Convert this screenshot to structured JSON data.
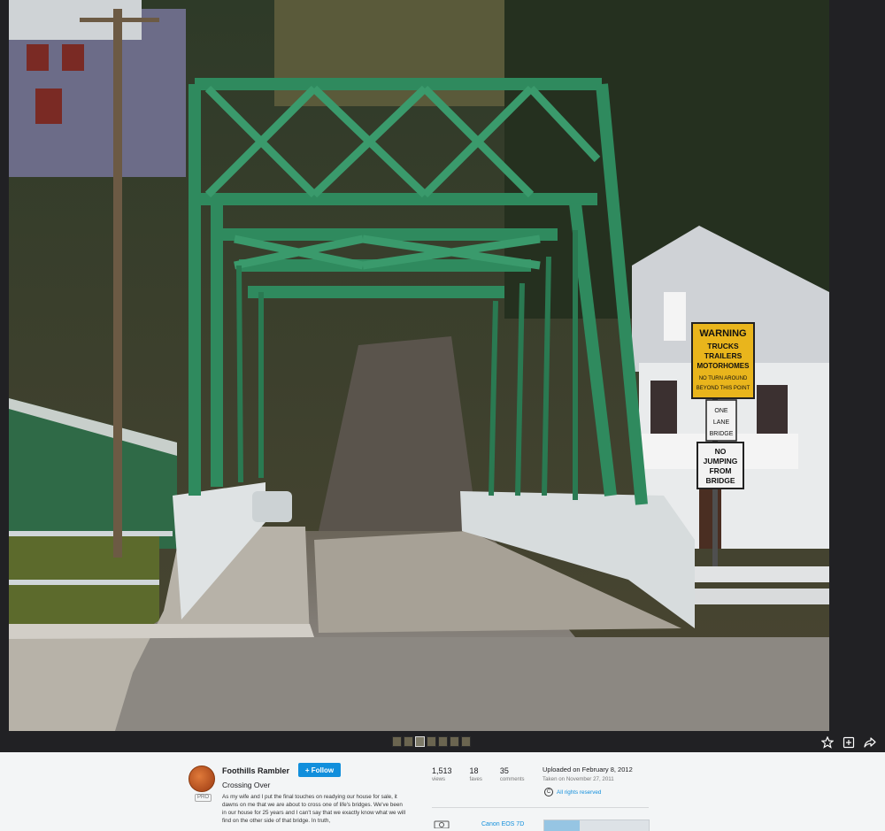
{
  "author": {
    "name": "Foothills Rambler",
    "badge": "PRO",
    "follow_label": "+ Follow"
  },
  "photo": {
    "title": "Crossing Over",
    "description": "As my wife and I put the final touches on readying our house for sale, it dawns on me that we are about to cross one of life's bridges. We've been in our house for 25 years and I can't say that we exactly know what we will find on the other side of that bridge. In truth,",
    "signs": {
      "warning": [
        "WARNING",
        "TRUCKS",
        "TRAILERS",
        "MOTORHOMES",
        "NO TURN AROUND",
        "BEYOND THIS POINT"
      ],
      "one_lane": [
        "ONE",
        "LANE",
        "BRIDGE"
      ],
      "no_jumping": [
        "NO",
        "JUMPING",
        "FROM",
        "BRIDGE"
      ]
    }
  },
  "stats": [
    {
      "value": "1,513",
      "label": "views"
    },
    {
      "value": "18",
      "label": "faves"
    },
    {
      "value": "35",
      "label": "comments"
    }
  ],
  "uploaded": "Uploaded on February 8, 2012",
  "taken": "Taken on November 27, 2011",
  "rights": {
    "icon": "copyright-icon",
    "label": "All rights reserved"
  },
  "camera": {
    "label": "Canon EOS 7D"
  },
  "filmstrip_count": 7,
  "filmstrip_active_index": 2,
  "colors": {
    "accent": "#128fdc",
    "viewer_bg": "#212124",
    "info_bg": "#f3f5f6",
    "bridge_green": "#2f8a5e"
  }
}
